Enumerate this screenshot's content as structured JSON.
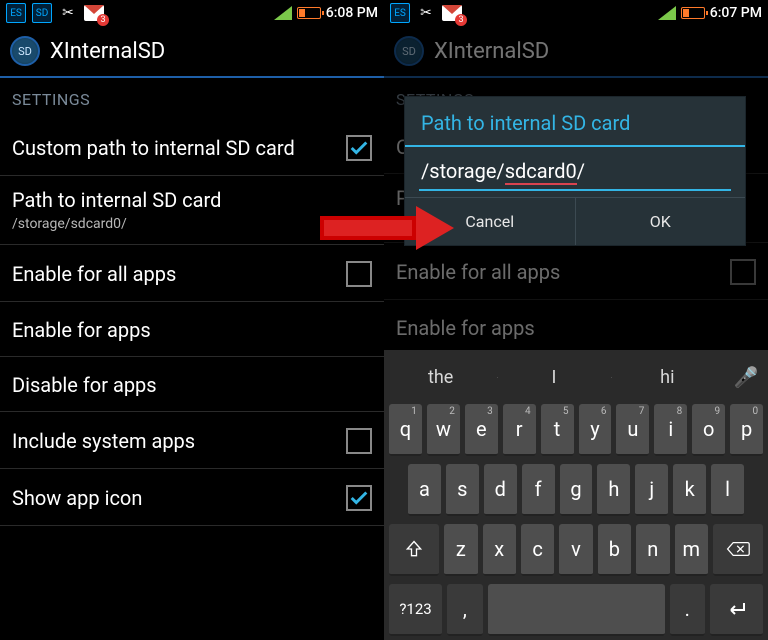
{
  "status": {
    "left_time": "6:08 PM",
    "right_time": "6:07 PM",
    "gmail_badge": "3"
  },
  "app": {
    "title": "XInternalSD",
    "icon_text": "SD"
  },
  "settings": {
    "header": "SETTINGS",
    "rows": {
      "custom_path": {
        "label": "Custom path to internal SD card",
        "checked": true
      },
      "path": {
        "label": "Path to internal SD card",
        "sub": "/storage/sdcard0/"
      },
      "enable_all": {
        "label": "Enable for all apps",
        "checked": false
      },
      "enable_apps": {
        "label": "Enable for apps"
      },
      "disable_apps": {
        "label": "Disable for apps"
      },
      "include_system": {
        "label": "Include system apps",
        "checked": false
      },
      "show_icon": {
        "label": "Show app icon",
        "checked": true
      }
    }
  },
  "dialog": {
    "title": "Path to internal SD card",
    "value_prefix": "/storage/",
    "value_err": "sdcard0",
    "value_suffix": "/",
    "cancel": "Cancel",
    "ok": "OK"
  },
  "keyboard": {
    "suggestions": [
      "the",
      "I",
      "hi"
    ],
    "row1": [
      {
        "k": "q",
        "h": "1"
      },
      {
        "k": "w",
        "h": "2"
      },
      {
        "k": "e",
        "h": "3"
      },
      {
        "k": "r",
        "h": "4"
      },
      {
        "k": "t",
        "h": "5"
      },
      {
        "k": "y",
        "h": "6"
      },
      {
        "k": "u",
        "h": "7"
      },
      {
        "k": "i",
        "h": "8"
      },
      {
        "k": "o",
        "h": "9"
      },
      {
        "k": "p",
        "h": "0"
      }
    ],
    "row2": [
      "a",
      "s",
      "d",
      "f",
      "g",
      "h",
      "j",
      "k",
      "l"
    ],
    "row3": [
      "z",
      "x",
      "c",
      "v",
      "b",
      "n",
      "m"
    ],
    "sym": "?123",
    "comma": ",",
    "period": "."
  }
}
